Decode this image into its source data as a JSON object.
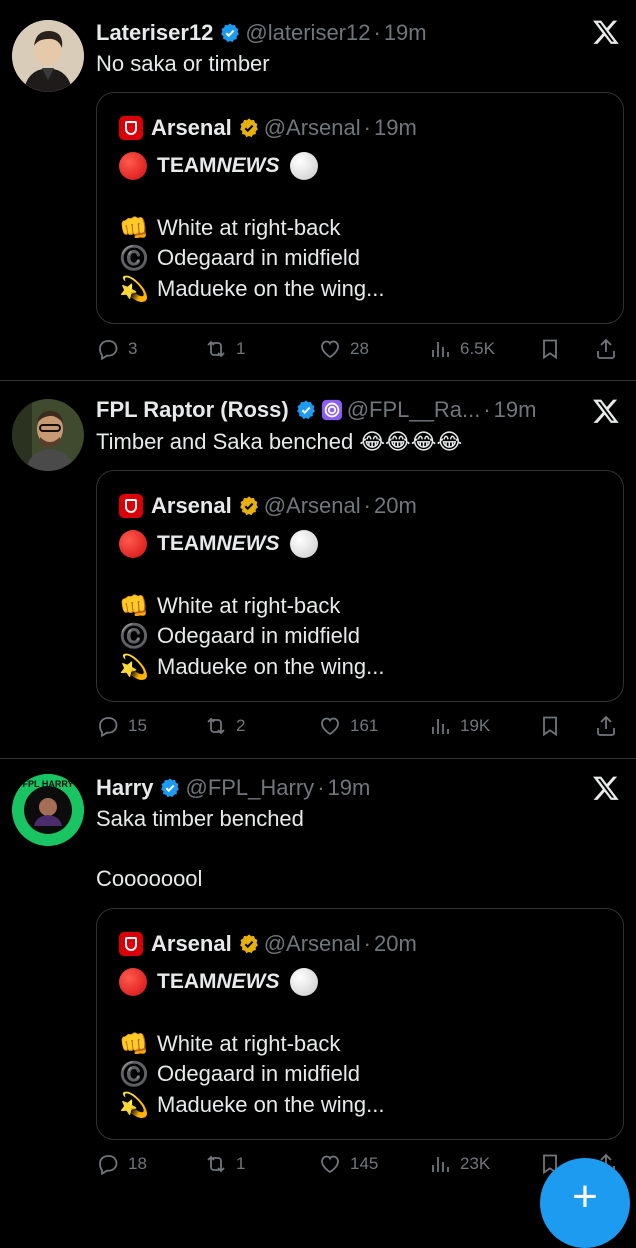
{
  "colors": {
    "background": "#000000",
    "text": "#e7e9ea",
    "muted": "#71767b",
    "border": "#2f3336",
    "verified_blue": "#1d9bf0",
    "verified_gold": "#e8b00c",
    "arsenal_red": "#db0007"
  },
  "tweets": [
    {
      "name": "Lateriser12",
      "handle": "@lateriser12",
      "dot": "·",
      "time": "19m",
      "text": "No saka or timber",
      "quote": {
        "name": "Arsenal",
        "handle": "@Arsenal",
        "dot": "·",
        "time": "19m",
        "team": "TEAM",
        "news": "NEWS",
        "lines": [
          {
            "emoji": "👊",
            "text": "White at right-back"
          },
          {
            "emoji": "©️",
            "text": "Odegaard in midfield"
          },
          {
            "emoji": "💫",
            "text": "Madueke on the wing..."
          }
        ]
      },
      "actions": {
        "replies": "3",
        "reposts": "1",
        "likes": "28",
        "views": "6.5K"
      }
    },
    {
      "name": "FPL Raptor (Ross)",
      "handle": "@FPL__Ra...",
      "dot": "·",
      "time": "19m",
      "text": "Timber and Saka benched 😂😂😂😂",
      "quote": {
        "name": "Arsenal",
        "handle": "@Arsenal",
        "dot": "·",
        "time": "20m",
        "team": "TEAM",
        "news": "NEWS",
        "lines": [
          {
            "emoji": "👊",
            "text": "White at right-back"
          },
          {
            "emoji": "©️",
            "text": "Odegaard in midfield"
          },
          {
            "emoji": "💫",
            "text": "Madueke on the wing..."
          }
        ]
      },
      "actions": {
        "replies": "15",
        "reposts": "2",
        "likes": "161",
        "views": "19K"
      }
    },
    {
      "name": "Harry",
      "handle": "@FPL_Harry",
      "dot": "·",
      "time": "19m",
      "text": "Saka timber benched\n\nCoooooool",
      "avatar_text": "FPL HARRY",
      "quote": {
        "name": "Arsenal",
        "handle": "@Arsenal",
        "dot": "·",
        "time": "20m",
        "team": "TEAM",
        "news": "NEWS",
        "lines": [
          {
            "emoji": "👊",
            "text": "White at right-back"
          },
          {
            "emoji": "©️",
            "text": "Odegaard in midfield"
          },
          {
            "emoji": "💫",
            "text": "Madueke on the wing..."
          }
        ]
      },
      "actions": {
        "replies": "18",
        "reposts": "1",
        "likes": "145",
        "views": "23K"
      }
    }
  ],
  "fab": {
    "label": "+",
    "icon": "plus-icon"
  }
}
